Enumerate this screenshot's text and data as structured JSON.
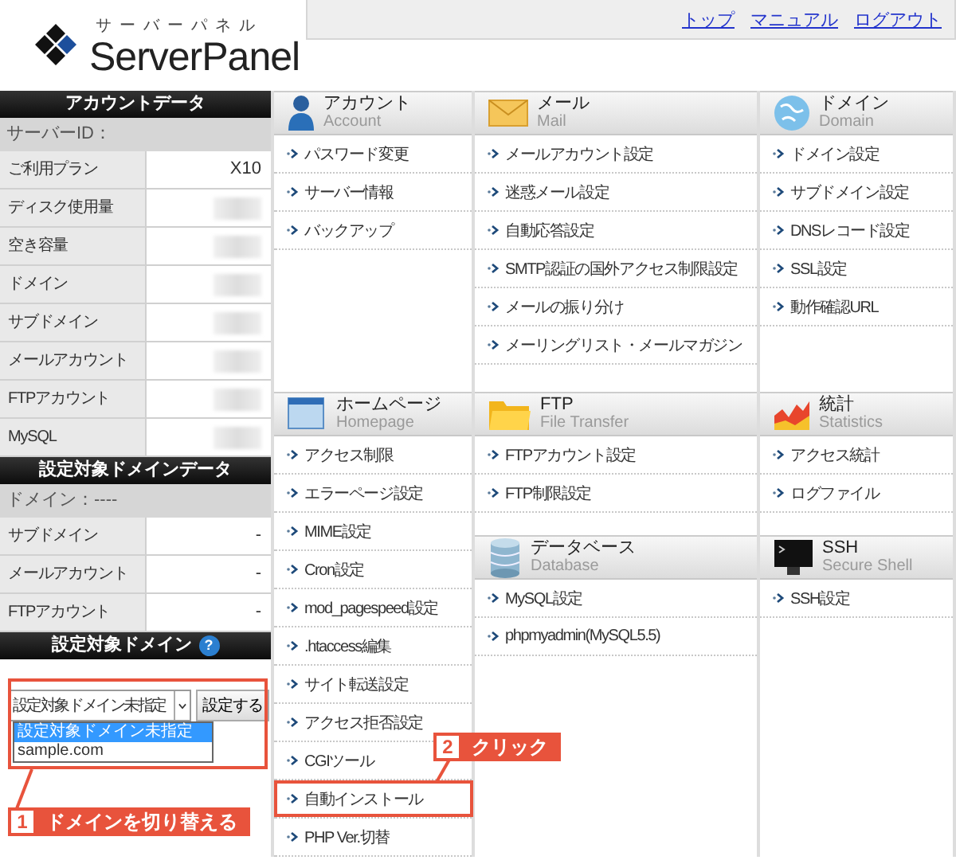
{
  "header": {
    "logo_kana": "サーバーパネル",
    "logo_name": "ServerPanel",
    "nav_links": [
      "トップ",
      "マニュアル",
      "ログアウト"
    ]
  },
  "account_data": {
    "title": "アカウントデータ",
    "server_id_label": "サーバーID：",
    "rows": [
      {
        "label": "ご利用プラン",
        "kind": "text",
        "value": "X10"
      },
      {
        "label": "ディスク使用量",
        "kind": "masked"
      },
      {
        "label": "空き容量",
        "kind": "masked"
      },
      {
        "label": "ドメイン",
        "kind": "masked"
      },
      {
        "label": "サブドメイン",
        "kind": "masked"
      },
      {
        "label": "メールアカウント",
        "kind": "masked"
      },
      {
        "label": "FTPアカウント",
        "kind": "masked"
      },
      {
        "label": "MySQL",
        "kind": "masked"
      }
    ]
  },
  "domain_data": {
    "title": "設定対象ドメインデータ",
    "domain_label": "ドメイン：----",
    "rows": [
      {
        "label": "サブドメイン",
        "kind": "text",
        "value": "-"
      },
      {
        "label": "メールアカウント",
        "kind": "text",
        "value": "-"
      },
      {
        "label": "FTPアカウント",
        "kind": "text",
        "value": "-"
      }
    ]
  },
  "domain_selector": {
    "title": "設定対象ドメイン",
    "help": "?",
    "select_value": "設定対象ドメイン未指定",
    "button": "設定する",
    "options": [
      {
        "label": "設定対象ドメイン未指定",
        "selected": true
      },
      {
        "label": "sample.com",
        "selected": false
      }
    ],
    "annotation": {
      "number": "1",
      "text": "ドメインを切り替える"
    }
  },
  "menu": [
    {
      "cells": [
        {
          "sections": [
            {
              "kind": "account",
              "title": "アカウント",
              "subtitle": "Account",
              "items": [
                {
                  "label": "パスワード変更"
                },
                {
                  "label": "サーバー情報"
                },
                {
                  "label": "バックアップ"
                }
              ]
            }
          ]
        },
        {
          "sections": [
            {
              "kind": "mail",
              "title": "メール",
              "subtitle": "Mail",
              "items": [
                {
                  "label": "メールアカウント設定"
                },
                {
                  "label": "迷惑メール設定"
                },
                {
                  "label": "自動応答設定"
                },
                {
                  "label": "SMTP認証の国外アクセス制限設定"
                },
                {
                  "label": "メールの振り分け"
                },
                {
                  "label": "メーリングリスト・メールマガジン"
                }
              ]
            }
          ]
        },
        {
          "sections": [
            {
              "kind": "domain",
              "title": "ドメイン",
              "subtitle": "Domain",
              "items": [
                {
                  "label": "ドメイン設定"
                },
                {
                  "label": "サブドメイン設定"
                },
                {
                  "label": "DNSレコード設定"
                },
                {
                  "label": "SSL設定"
                },
                {
                  "label": "動作確認URL"
                }
              ]
            }
          ]
        }
      ]
    },
    {
      "cells": [
        {
          "sections": [
            {
              "kind": "homepage",
              "title": "ホームページ",
              "subtitle": "Homepage",
              "items": [
                {
                  "label": "アクセス制限"
                },
                {
                  "label": "エラーページ設定"
                },
                {
                  "label": "MIME設定"
                },
                {
                  "label": "Cron設定"
                },
                {
                  "label": "mod_pagespeed設定"
                },
                {
                  "label": ".htaccess編集"
                },
                {
                  "label": "サイト転送設定"
                },
                {
                  "label": "アクセス拒否設定"
                },
                {
                  "label": "CGIツール"
                },
                {
                  "label": "自動インストール",
                  "annotation": {
                    "number": "2",
                    "text": "クリック"
                  }
                },
                {
                  "label": "PHP Ver.切替"
                }
              ]
            }
          ]
        },
        {
          "sections": [
            {
              "kind": "ftp",
              "title": "FTP",
              "subtitle": "File Transfer",
              "items": [
                {
                  "label": "FTPアカウント設定"
                },
                {
                  "label": "FTP制限設定"
                }
              ]
            },
            {
              "kind": "database",
              "title": "データベース",
              "subtitle": "Database",
              "items": [
                {
                  "label": "MySQL設定"
                },
                {
                  "label": "phpmyadmin(MySQL5.5)"
                }
              ]
            }
          ]
        },
        {
          "sections": [
            {
              "kind": "statistics",
              "title": "統計",
              "subtitle": "Statistics",
              "items": [
                {
                  "label": "アクセス統計"
                },
                {
                  "label": "ログファイル"
                }
              ]
            },
            {
              "kind": "ssh",
              "title": "SSH",
              "subtitle": "Secure Shell",
              "items": [
                {
                  "label": "SSH設定"
                }
              ]
            }
          ]
        }
      ]
    }
  ]
}
